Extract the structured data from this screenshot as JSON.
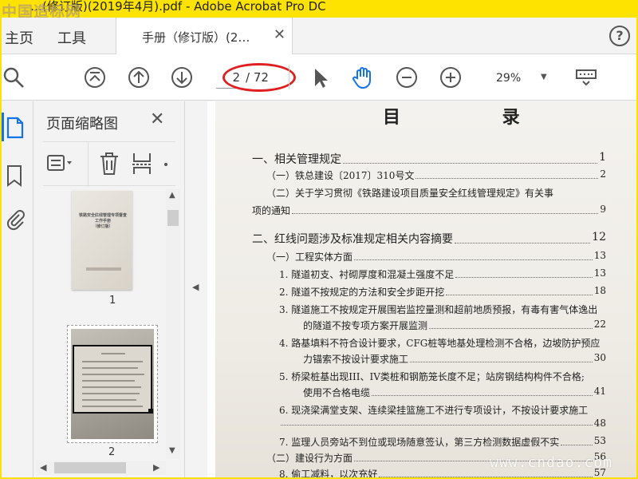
{
  "window": {
    "title": "…(修订版)(2019年4月).pdf - Adobe Acrobat Pro DC",
    "watermark": "中国造标网"
  },
  "tabs": {
    "home": "主页",
    "tools": "工具",
    "document": "手册（修订版）(2…",
    "help": "?"
  },
  "toolbar": {
    "current_page": "2",
    "total_pages": "/ 72",
    "zoom": "29%",
    "icons": [
      "search-icon",
      "first-page-icon",
      "previous-page-icon",
      "next-page-icon",
      "select-arrow-icon",
      "hand-tool-icon",
      "zoom-out-icon",
      "zoom-in-icon",
      "keyboard-icon"
    ]
  },
  "panel": {
    "title": "页面缩略图",
    "thumb1_title": "铁路安全红线管理专项督查工作手册",
    "thumb1_sub": "（修订版）",
    "thumbnails": [
      {
        "label": "1"
      },
      {
        "label": "2"
      }
    ]
  },
  "document": {
    "title": "目 录",
    "entries": [
      {
        "text": "一、相关管理规定",
        "page": "1"
      },
      {
        "text": "（一）铁总建设〔2017〕310号文",
        "page": "2"
      },
      {
        "text": "（二）关于学习贯彻《铁路建设项目质量安全红线管理规定》有关事",
        "page": ""
      },
      {
        "text": "项的通知",
        "page": "9"
      },
      {
        "text": "二、红线问题涉及标准规定相关内容摘要",
        "page": "12"
      },
      {
        "text": "（一）工程实体方面",
        "page": "13"
      },
      {
        "text": "1. 隧道初支、衬砌厚度和混凝土强度不足",
        "page": "13"
      },
      {
        "text": "2. 隧道不按规定的方法和安全步距开挖",
        "page": "18"
      },
      {
        "text": "3. 隧道施工不按规定开展围岩监控量测和超前地质预报，有毒有害气体逸出",
        "page": ""
      },
      {
        "text": "的隧道不按专项方案开展监测",
        "page": "22"
      },
      {
        "text": "4. 路基填料不符合设计要求，CFG桩等地基处理检测不合格，边坡防护预应",
        "page": ""
      },
      {
        "text": "力锚索不按设计要求施工",
        "page": "30"
      },
      {
        "text": "5. 桥梁桩基出现III、IV类桩和钢筋笼长度不足；站房钢结构构件不合格;",
        "page": ""
      },
      {
        "text": "使用不合格电缆",
        "page": "41"
      },
      {
        "text": "6. 现浇梁满堂支架、连续梁挂篮施工不进行专项设计，不按设计要求施工",
        "page": ""
      },
      {
        "text": "",
        "page": "48"
      },
      {
        "text": "7. 监理人员旁站不到位或现场随意签认，第三方检测数据虚假不实",
        "page": "53"
      },
      {
        "text": "（二）建设行为方面",
        "page": "56"
      },
      {
        "text": "8. 偷工减料，以次充好",
        "page": "57"
      }
    ],
    "watermark": "www.cndao.com"
  }
}
